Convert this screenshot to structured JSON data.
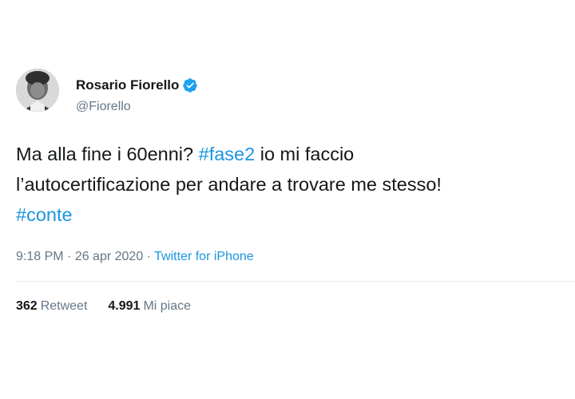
{
  "user": {
    "display_name": "Rosario Fiorello",
    "handle": "@Fiorello",
    "verified": true,
    "verified_color": "#1da1f2"
  },
  "tweet": {
    "line1_pre": "Ma alla fine i 60enni? ",
    "line1_hashtag": "#fase2",
    "line1_post": " io mi faccio",
    "line2": "l’autocertificazione per andare a trovare me stesso!",
    "line3_hashtag": "#conte"
  },
  "meta": {
    "time": "9:18 PM",
    "separator1": " · ",
    "date": "26 apr 2020",
    "separator2": " · ",
    "source": "Twitter for iPhone"
  },
  "stats": {
    "retweets_count": "362",
    "retweets_label": "Retweet",
    "likes_count": "4.991",
    "likes_label": "Mi piace"
  },
  "colors": {
    "link": "#1b95e0",
    "secondary_text": "#657786",
    "primary_text": "#14171a"
  }
}
